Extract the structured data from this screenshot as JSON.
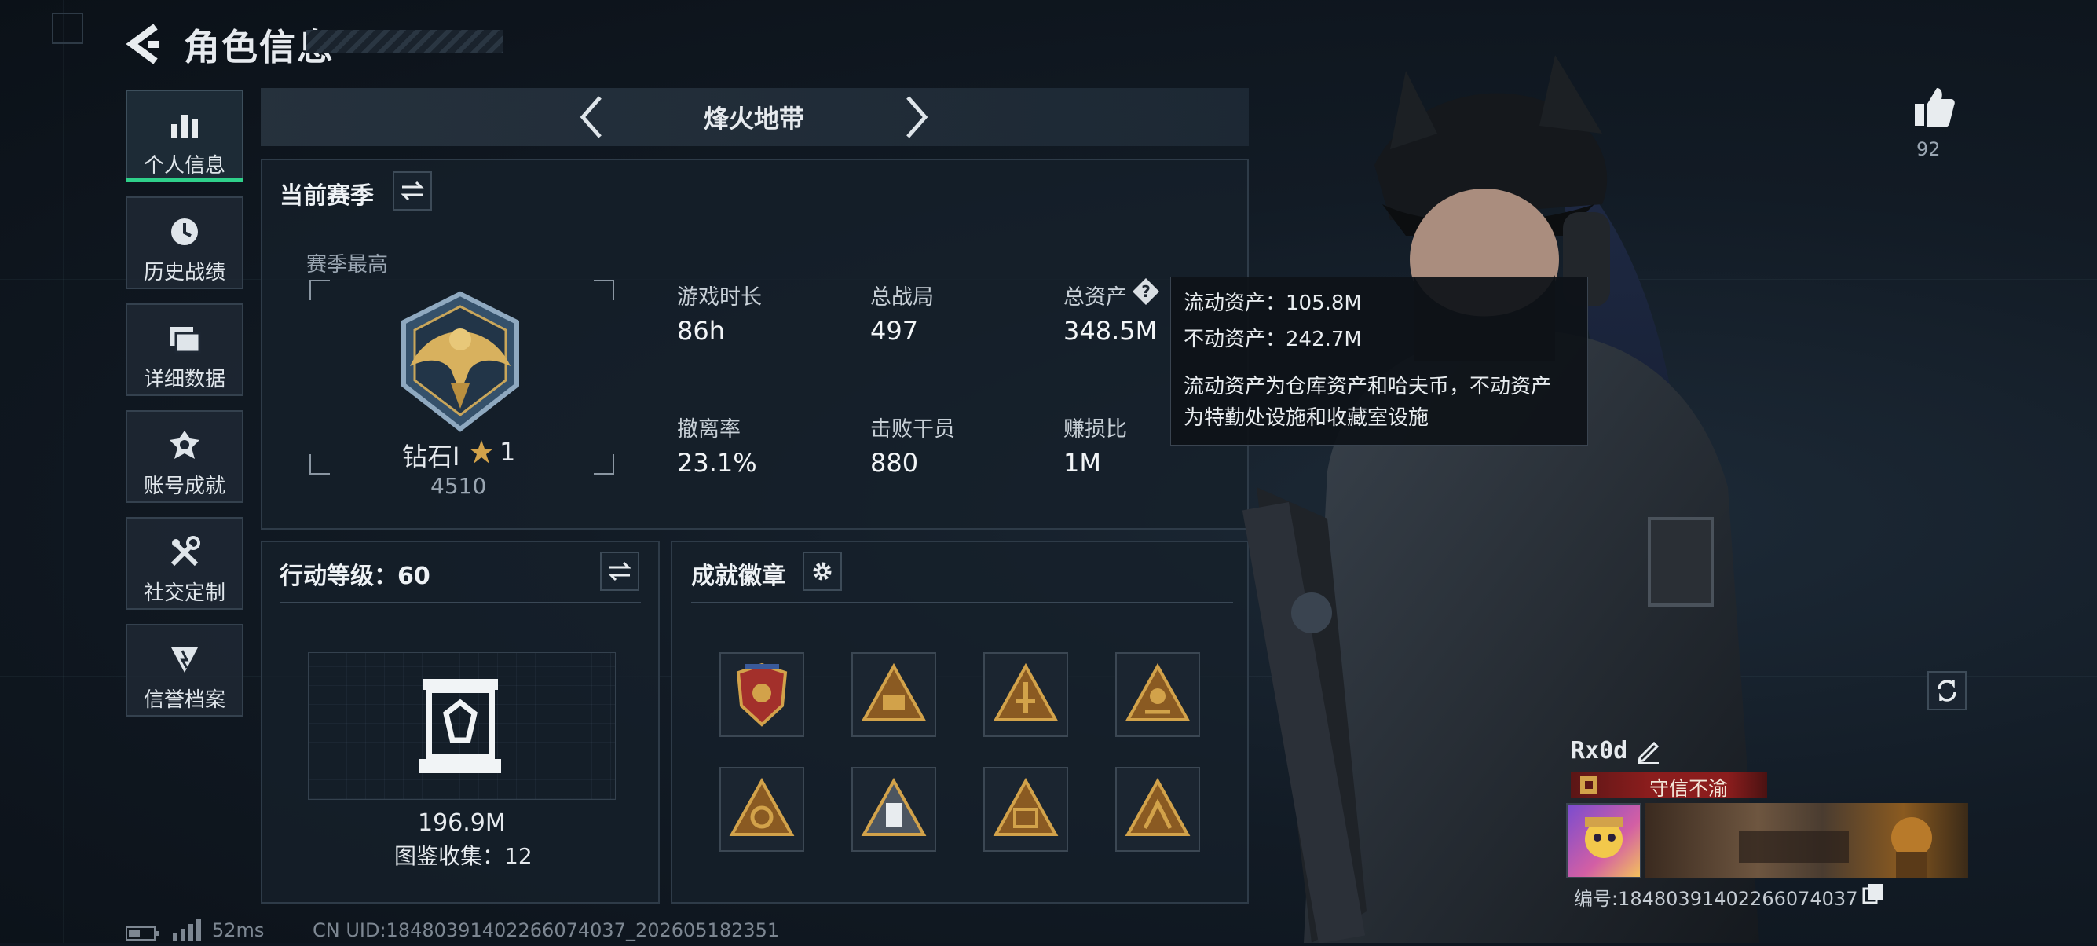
{
  "header": {
    "title": "角色信息"
  },
  "sidebar": {
    "items": [
      {
        "label": "个人信息",
        "icon": "bar-chart-icon",
        "active": true
      },
      {
        "label": "历史战绩",
        "icon": "history-icon"
      },
      {
        "label": "详细数据",
        "icon": "folder-icon"
      },
      {
        "label": "账号成就",
        "icon": "achievement-icon"
      },
      {
        "label": "社交定制",
        "icon": "tools-icon"
      },
      {
        "label": "信誉档案",
        "icon": "credit-icon"
      }
    ]
  },
  "mode_selector": {
    "label": "烽火地带"
  },
  "season": {
    "title": "当前赛季",
    "best_label": "赛季最高",
    "rank_name": "钻石Ⅰ",
    "rank_stars": "1",
    "rank_points": "4510",
    "stats": [
      {
        "label": "游戏时长",
        "value": "86h"
      },
      {
        "label": "总战局",
        "value": "497"
      },
      {
        "label": "总资产",
        "value": "348.5M"
      },
      {
        "label": "撤离率",
        "value": "23.1%"
      },
      {
        "label": "击败干员",
        "value": "880"
      },
      {
        "label": "赚损比",
        "value": "1M"
      }
    ]
  },
  "tooltip": {
    "line1": "流动资产：105.8M",
    "line2": "不动资产：242.7M",
    "line3": "流动资产为仓库资产和哈夫币，不动资产",
    "line4": "为特勤处设施和收藏室设施"
  },
  "action_level": {
    "title": "行动等级：60",
    "value": "196.9M",
    "collection": "图鉴收集：12"
  },
  "achievements": {
    "title": "成就徽章"
  },
  "likes": {
    "count": "92"
  },
  "player": {
    "name": "Rx0d",
    "title": "守信不渝",
    "id_text": "编号:18480391402266074037"
  },
  "status_bar": {
    "ping": "52ms",
    "uid": "CN UID:18480391402266074037_202605182351"
  },
  "colors": {
    "accent": "#2fd08a",
    "gold": "#d2a24a",
    "title_red": "#8b1d1d"
  }
}
